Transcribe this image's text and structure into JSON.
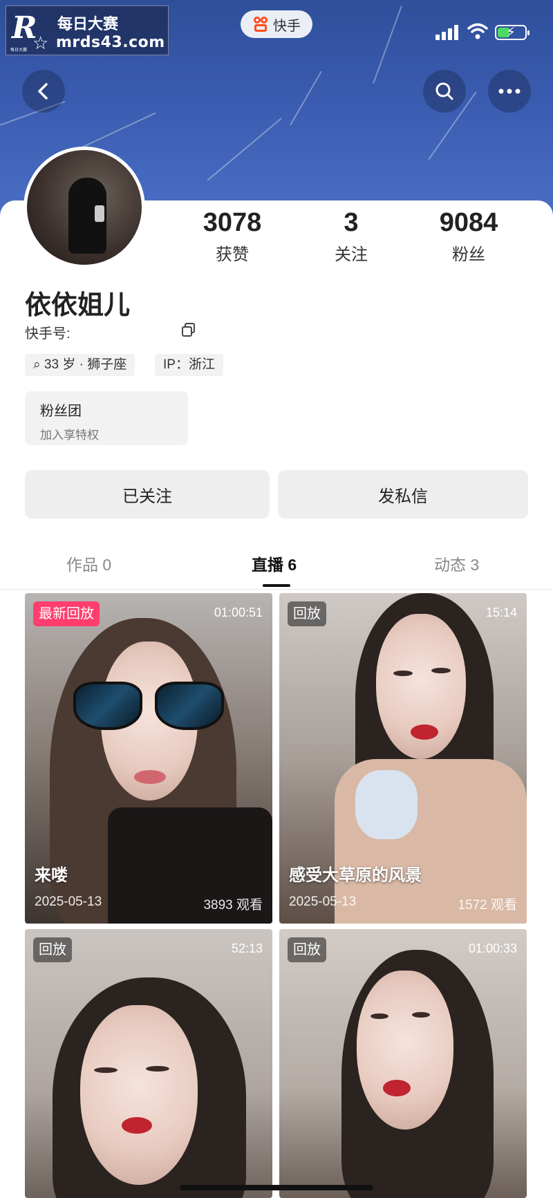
{
  "watermark": {
    "logo": "R",
    "small": "每日大赛",
    "top": "每日大赛",
    "bottom": "mrds43.com"
  },
  "header": {
    "app_name": "快手",
    "battery_level": 0.45
  },
  "stats": [
    {
      "value": "3078",
      "label": "获赞"
    },
    {
      "value": "3",
      "label": "关注"
    },
    {
      "value": "9084",
      "label": "粉丝"
    }
  ],
  "profile": {
    "name": "依依姐儿",
    "kuaishou_id_label": "快手号:",
    "tags": [
      "33 岁 · 狮子座",
      "IP：浙江"
    ]
  },
  "fan_club": {
    "title": "粉丝团",
    "subtitle": "加入享特权"
  },
  "actions": {
    "following": "已关注",
    "message": "发私信"
  },
  "tabs": [
    {
      "label": "作品 0"
    },
    {
      "label": "直播 6"
    },
    {
      "label": "动态 3"
    }
  ],
  "videos": [
    {
      "badge": "最新回放",
      "duration": "01:00:51",
      "title": "来喽",
      "date": "2025-05-13",
      "views": "3893 观看"
    },
    {
      "badge": "回放",
      "duration": "15:14",
      "title": "感受大草原的风景",
      "date": "2025-05-13",
      "views": "1572 观看"
    },
    {
      "badge": "回放",
      "duration": "52:13",
      "title": "",
      "date": "",
      "views": ""
    },
    {
      "badge": "回放",
      "duration": "01:00:33",
      "title": "",
      "date": "",
      "views": ""
    }
  ],
  "icons": {
    "back": "chevron-left-icon",
    "search": "search-icon",
    "more": "more-dots-icon",
    "copy": "copy-icon",
    "app_logo": "kuaishou-logo-icon",
    "signal": "cellular-signal-icon",
    "wifi": "wifi-icon",
    "battery": "battery-charging-icon"
  }
}
